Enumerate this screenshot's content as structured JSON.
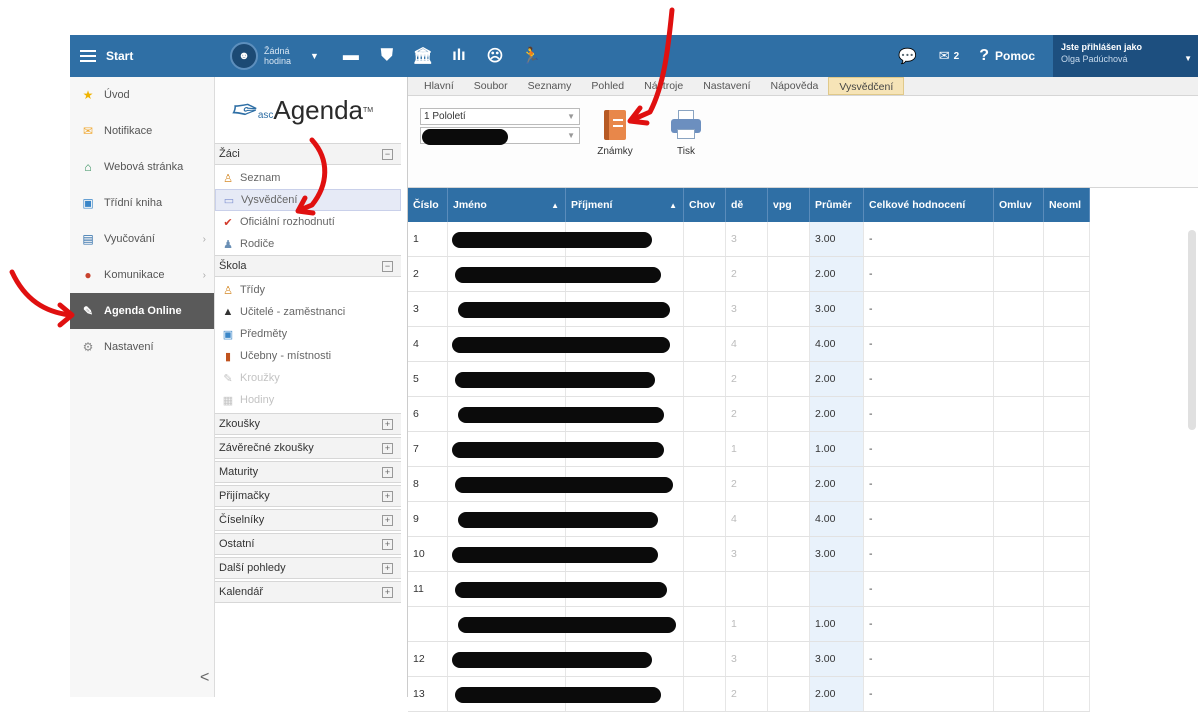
{
  "topbar": {
    "start_label": "Start",
    "hour_label": "Žádná hodina",
    "count_label": "2",
    "help_label": "Pomoc",
    "user_line1": "Jste přihlášen jako",
    "user_line2": "Olga Padúchová",
    "brand_color": "#2f6fa5"
  },
  "leftnav": {
    "items": [
      {
        "label": "Úvod",
        "icon": "star-icon"
      },
      {
        "label": "Notifikace",
        "icon": "envelope-icon"
      },
      {
        "label": "Webová stránka",
        "icon": "house-icon"
      },
      {
        "label": "Třídní kniha",
        "icon": "book-icon"
      },
      {
        "label": "Vyučování",
        "icon": "briefcase-icon"
      },
      {
        "label": "Komunikace",
        "icon": "people-icon"
      },
      {
        "label": "Agenda Online",
        "icon": "feather-icon"
      },
      {
        "label": "Nastavení",
        "icon": "gear-icon"
      }
    ],
    "collapse_label": "<"
  },
  "tree": {
    "logo_asc": "asc",
    "logo_agenda": "Agenda",
    "logo_tm": "TM",
    "zaci": "Žáci",
    "zaci_items": [
      "Seznam",
      "Vysvědčení",
      "Oficiální rozhodnutí",
      "Rodiče"
    ],
    "skola": "Škola",
    "skola_items": [
      "Třídy",
      "Učitelé - zaměstnanci",
      "Předměty",
      "Učebny - místnosti",
      "Kroužky",
      "Hodiny"
    ],
    "groups": [
      "Zkoušky",
      "Závěrečné zkoušky",
      "Maturity",
      "Přijímačky",
      "Číselníky",
      "Ostatní",
      "Další pohledy",
      "Kalendář"
    ]
  },
  "menubar": {
    "tabs": [
      "Hlavní",
      "Soubor",
      "Seznamy",
      "Pohled",
      "Nástroje",
      "Nastavení",
      "Nápověda",
      "Vysvědčení"
    ],
    "active": "Vysvědčení"
  },
  "ribbon": {
    "term_select": "1 Pololetí",
    "znamky_label": "Známky",
    "tisk_label": "Tisk"
  },
  "grid": {
    "headers": [
      "Číslo",
      "Jméno",
      "Příjmení",
      "Chov",
      "dě",
      "vpg",
      "Průměr",
      "Celkové hodnocení",
      "Omluv",
      "Neoml"
    ],
    "rows": [
      {
        "cislo": "1",
        "de": "3",
        "prumer": "3.00",
        "celkove": "-"
      },
      {
        "cislo": "2",
        "de": "2",
        "prumer": "2.00",
        "celkove": "-"
      },
      {
        "cislo": "3",
        "de": "3",
        "prumer": "3.00",
        "celkove": "-"
      },
      {
        "cislo": "4",
        "de": "4",
        "prumer": "4.00",
        "celkove": "-"
      },
      {
        "cislo": "5",
        "de": "2",
        "prumer": "2.00",
        "celkove": "-"
      },
      {
        "cislo": "6",
        "de": "2",
        "prumer": "2.00",
        "celkove": "-"
      },
      {
        "cislo": "7",
        "de": "1",
        "prumer": "1.00",
        "celkove": "-"
      },
      {
        "cislo": "8",
        "de": "2",
        "prumer": "2.00",
        "celkove": "-"
      },
      {
        "cislo": "9",
        "de": "4",
        "prumer": "4.00",
        "celkove": "-"
      },
      {
        "cislo": "10",
        "de": "3",
        "prumer": "3.00",
        "celkove": "-"
      },
      {
        "cislo": "11",
        "de": "",
        "prumer": "",
        "celkove": "-"
      },
      {
        "cislo": "",
        "de": "1",
        "prumer": "1.00",
        "celkove": "-"
      },
      {
        "cislo": "12",
        "de": "3",
        "prumer": "3.00",
        "celkove": "-"
      },
      {
        "cislo": "13",
        "de": "2",
        "prumer": "2.00",
        "celkove": "-"
      }
    ]
  }
}
